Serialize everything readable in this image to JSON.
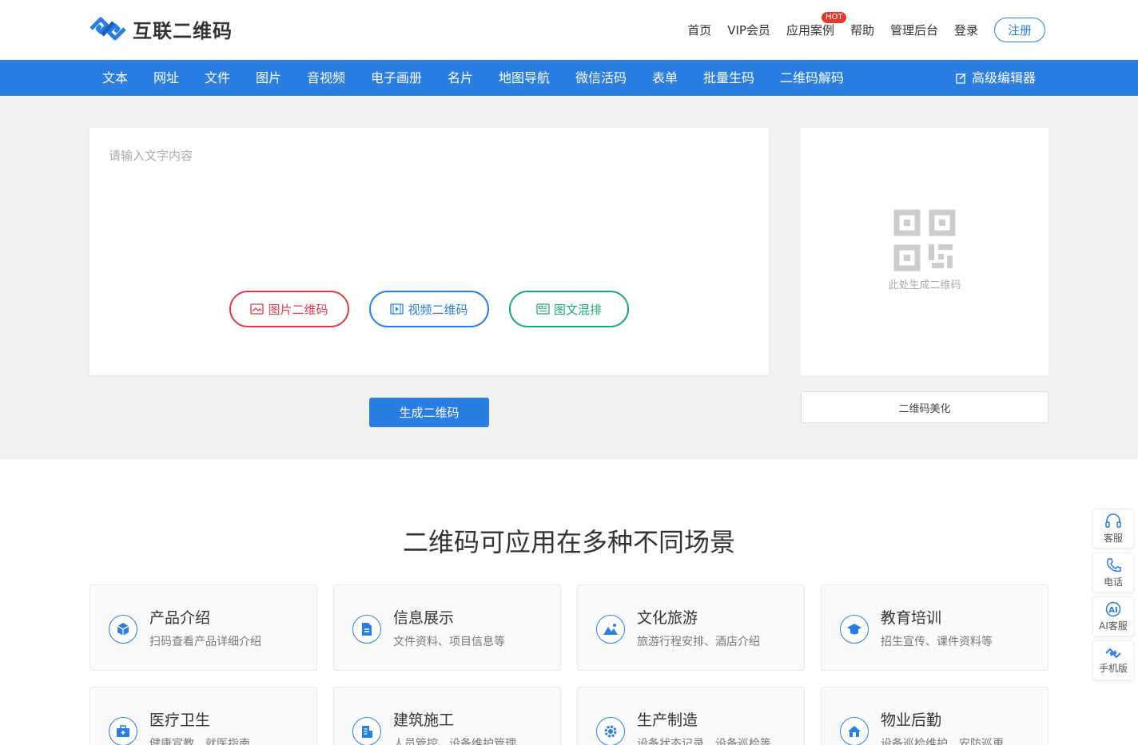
{
  "brand": {
    "name": "互联二维码"
  },
  "topnav": {
    "items": [
      "首页",
      "VIP会员",
      "应用案例",
      "帮助",
      "管理后台",
      "登录"
    ],
    "hot_badge": "HOT",
    "register": "注册"
  },
  "tabs": [
    "文本",
    "网址",
    "文件",
    "图片",
    "音视频",
    "电子画册",
    "名片",
    "地图导航",
    "微信活码",
    "表单",
    "批量生码",
    "二维码解码"
  ],
  "editor_link": "高级编辑器",
  "editor": {
    "placeholder": "请输入文字内容",
    "buttons": {
      "image_qr": "图片二维码",
      "video_qr": "视频二维码",
      "mixed": "图文混排"
    },
    "generate": "生成二维码"
  },
  "preview": {
    "caption": "此处生成二维码",
    "beautify": "二维码美化"
  },
  "scenarios": {
    "title": "二维码可应用在多种不同场景",
    "cards": [
      {
        "title": "产品介绍",
        "desc": "扫码查看产品详细介绍",
        "icon": "box-icon"
      },
      {
        "title": "信息展示",
        "desc": "文件资料、项目信息等",
        "icon": "document-icon"
      },
      {
        "title": "文化旅游",
        "desc": "旅游行程安排、酒店介绍",
        "icon": "landscape-icon"
      },
      {
        "title": "教育培训",
        "desc": "招生宣传、课件资料等",
        "icon": "graduation-cap-icon"
      },
      {
        "title": "医疗卫生",
        "desc": "健康宣教、就医指南",
        "icon": "medical-kit-icon"
      },
      {
        "title": "建筑施工",
        "desc": "人员管控、设备维护管理",
        "icon": "building-icon"
      },
      {
        "title": "生产制造",
        "desc": "设备状态记录、设备巡检等",
        "icon": "gear-icon"
      },
      {
        "title": "物业后勤",
        "desc": "设备巡检维护、安防巡更",
        "icon": "house-icon"
      }
    ]
  },
  "side_float": [
    "客服",
    "电话",
    "AI客服",
    "手机版"
  ],
  "colors": {
    "primary": "#2a7de1",
    "red": "#e03a4a",
    "green": "#1aaa72",
    "hot": "#e8382e"
  }
}
